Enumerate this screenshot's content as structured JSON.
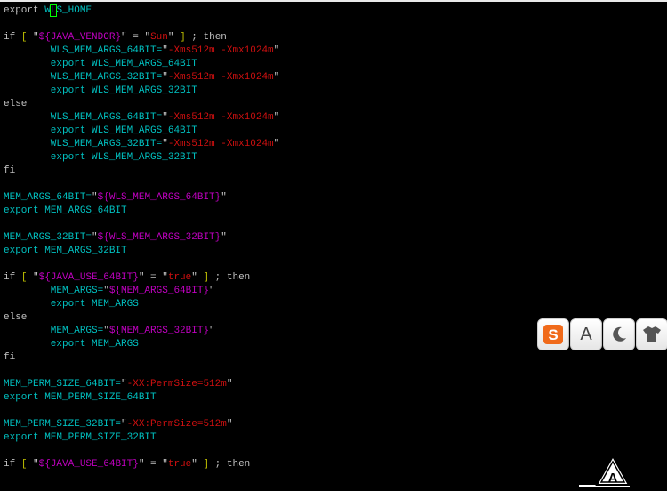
{
  "lines": [
    [
      {
        "t": "export ",
        "c": "k"
      },
      {
        "t": "W",
        "c": "v"
      },
      {
        "t": "L",
        "c": "v",
        "cursor": true
      },
      {
        "t": "S_HOME",
        "c": "v"
      }
    ],
    [],
    [
      {
        "t": "if ",
        "c": "k"
      },
      {
        "t": "[",
        "c": "y"
      },
      {
        "t": " \"",
        "c": "k"
      },
      {
        "t": "${JAVA_VENDOR}",
        "c": "m"
      },
      {
        "t": "\" = \"",
        "c": "k"
      },
      {
        "t": "Sun",
        "c": "s"
      },
      {
        "t": "\" ",
        "c": "k"
      },
      {
        "t": "]",
        "c": "y"
      },
      {
        "t": " ; then",
        "c": "k"
      }
    ],
    [
      {
        "t": "        WLS_MEM_ARGS_64BIT=",
        "c": "v"
      },
      {
        "t": "\"",
        "c": "k"
      },
      {
        "t": "-Xms512m -Xmx1024m",
        "c": "s"
      },
      {
        "t": "\"",
        "c": "k"
      }
    ],
    [
      {
        "t": "        export ",
        "c": "v"
      },
      {
        "t": "WLS_MEM_ARGS_64BIT",
        "c": "v"
      }
    ],
    [
      {
        "t": "        WLS_MEM_ARGS_32BIT=",
        "c": "v"
      },
      {
        "t": "\"",
        "c": "k"
      },
      {
        "t": "-Xms512m -Xmx1024m",
        "c": "s"
      },
      {
        "t": "\"",
        "c": "k"
      }
    ],
    [
      {
        "t": "        export ",
        "c": "v"
      },
      {
        "t": "WLS_MEM_ARGS_32BIT",
        "c": "v"
      }
    ],
    [
      {
        "t": "else",
        "c": "k"
      }
    ],
    [
      {
        "t": "        WLS_MEM_ARGS_64BIT=",
        "c": "v"
      },
      {
        "t": "\"",
        "c": "k"
      },
      {
        "t": "-Xms512m -Xmx1024m",
        "c": "s"
      },
      {
        "t": "\"",
        "c": "k"
      }
    ],
    [
      {
        "t": "        export ",
        "c": "v"
      },
      {
        "t": "WLS_MEM_ARGS_64BIT",
        "c": "v"
      }
    ],
    [
      {
        "t": "        WLS_MEM_ARGS_32BIT=",
        "c": "v"
      },
      {
        "t": "\"",
        "c": "k"
      },
      {
        "t": "-Xms512m -Xmx1024m",
        "c": "s"
      },
      {
        "t": "\"",
        "c": "k"
      }
    ],
    [
      {
        "t": "        export ",
        "c": "v"
      },
      {
        "t": "WLS_MEM_ARGS_32BIT",
        "c": "v"
      }
    ],
    [
      {
        "t": "fi",
        "c": "k"
      }
    ],
    [],
    [
      {
        "t": "MEM_ARGS_64BIT=",
        "c": "v"
      },
      {
        "t": "\"",
        "c": "k"
      },
      {
        "t": "${WLS_MEM_ARGS_64BIT}",
        "c": "m"
      },
      {
        "t": "\"",
        "c": "k"
      }
    ],
    [
      {
        "t": "export ",
        "c": "v"
      },
      {
        "t": "MEM_ARGS_64BIT",
        "c": "v"
      }
    ],
    [],
    [
      {
        "t": "MEM_ARGS_32BIT=",
        "c": "v"
      },
      {
        "t": "\"",
        "c": "k"
      },
      {
        "t": "${WLS_MEM_ARGS_32BIT}",
        "c": "m"
      },
      {
        "t": "\"",
        "c": "k"
      }
    ],
    [
      {
        "t": "export ",
        "c": "v"
      },
      {
        "t": "MEM_ARGS_32BIT",
        "c": "v"
      }
    ],
    [],
    [
      {
        "t": "if ",
        "c": "k"
      },
      {
        "t": "[",
        "c": "y"
      },
      {
        "t": " \"",
        "c": "k"
      },
      {
        "t": "${JAVA_USE_64BIT}",
        "c": "m"
      },
      {
        "t": "\" = \"",
        "c": "k"
      },
      {
        "t": "true",
        "c": "s"
      },
      {
        "t": "\" ",
        "c": "k"
      },
      {
        "t": "]",
        "c": "y"
      },
      {
        "t": " ; then",
        "c": "k"
      }
    ],
    [
      {
        "t": "        MEM_ARGS=",
        "c": "v"
      },
      {
        "t": "\"",
        "c": "k"
      },
      {
        "t": "${MEM_ARGS_64BIT}",
        "c": "m"
      },
      {
        "t": "\"",
        "c": "k"
      }
    ],
    [
      {
        "t": "        export ",
        "c": "v"
      },
      {
        "t": "MEM_ARGS",
        "c": "v"
      }
    ],
    [
      {
        "t": "else",
        "c": "k"
      }
    ],
    [
      {
        "t": "        MEM_ARGS=",
        "c": "v"
      },
      {
        "t": "\"",
        "c": "k"
      },
      {
        "t": "${MEM_ARGS_32BIT}",
        "c": "m"
      },
      {
        "t": "\"",
        "c": "k"
      }
    ],
    [
      {
        "t": "        export ",
        "c": "v"
      },
      {
        "t": "MEM_ARGS",
        "c": "v"
      }
    ],
    [
      {
        "t": "fi",
        "c": "k"
      }
    ],
    [],
    [
      {
        "t": "MEM_PERM_SIZE_64BIT=",
        "c": "v"
      },
      {
        "t": "\"",
        "c": "k"
      },
      {
        "t": "-XX:PermSize=512m",
        "c": "s"
      },
      {
        "t": "\"",
        "c": "k"
      }
    ],
    [
      {
        "t": "export ",
        "c": "v"
      },
      {
        "t": "MEM_PERM_SIZE_64BIT",
        "c": "v"
      }
    ],
    [],
    [
      {
        "t": "MEM_PERM_SIZE_32BIT=",
        "c": "v"
      },
      {
        "t": "\"",
        "c": "k"
      },
      {
        "t": "-XX:PermSize=512m",
        "c": "s"
      },
      {
        "t": "\"",
        "c": "k"
      }
    ],
    [
      {
        "t": "export ",
        "c": "v"
      },
      {
        "t": "MEM_PERM_SIZE_32BIT",
        "c": "v"
      }
    ],
    [],
    [
      {
        "t": "if ",
        "c": "k"
      },
      {
        "t": "[",
        "c": "y"
      },
      {
        "t": " \"",
        "c": "k"
      },
      {
        "t": "${JAVA_USE_64BIT}",
        "c": "m"
      },
      {
        "t": "\" = \"",
        "c": "k"
      },
      {
        "t": "true",
        "c": "s"
      },
      {
        "t": "\" ",
        "c": "k"
      },
      {
        "t": "]",
        "c": "y"
      },
      {
        "t": " ; then",
        "c": "k"
      }
    ]
  ],
  "toolbar": {
    "buttons": [
      {
        "name": "sogou-logo-button",
        "icon": "s-logo-icon",
        "glyph": "S"
      },
      {
        "name": "font-button",
        "icon": "letter-a-icon",
        "glyph": "A"
      },
      {
        "name": "night-mode-button",
        "icon": "moon-icon"
      },
      {
        "name": "skin-button",
        "icon": "shirt-icon"
      }
    ]
  },
  "corner_logo": {
    "icon": "a-triangle-logo-icon",
    "glyph": "A"
  },
  "colors": {
    "background": "#000000",
    "cyan": "#00c0c0",
    "red": "#d01010",
    "magenta": "#c000c0",
    "yellow": "#c0c000",
    "plain": "#c0c0c0",
    "sogou_orange": "#f06a1a"
  }
}
